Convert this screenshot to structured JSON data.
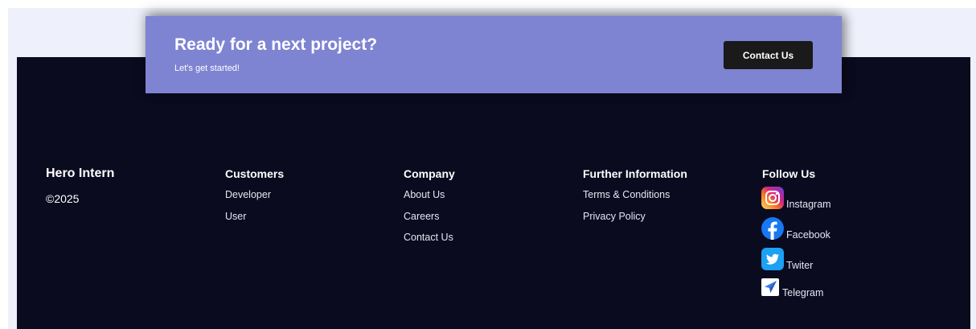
{
  "cta": {
    "title": "Ready for a next project?",
    "subtitle": "Let's get started!",
    "button_label": "Contact Us"
  },
  "brand": {
    "name": "Hero Intern",
    "copyright": "©2025"
  },
  "columns": [
    {
      "heading": "Customers",
      "links": [
        "Developer",
        "User"
      ]
    },
    {
      "heading": "Company",
      "links": [
        "About Us",
        "Careers",
        "Contact Us"
      ]
    },
    {
      "heading": "Further Information",
      "links": [
        "Terms & Conditions",
        "Privacy Policy"
      ]
    }
  ],
  "follow": {
    "heading": "Follow Us",
    "items": [
      {
        "label": "Instagram",
        "icon": "instagram-icon"
      },
      {
        "label": "Facebook",
        "icon": "facebook-icon"
      },
      {
        "label": "Twiter",
        "icon": "twitter-icon"
      },
      {
        "label": "Telegram",
        "icon": "telegram-icon"
      }
    ]
  },
  "colors": {
    "cta_background": "#7e84d2",
    "footer_background": "#0b0b20",
    "button_background": "#1a1a1a",
    "page_background": "#eef1fb"
  }
}
